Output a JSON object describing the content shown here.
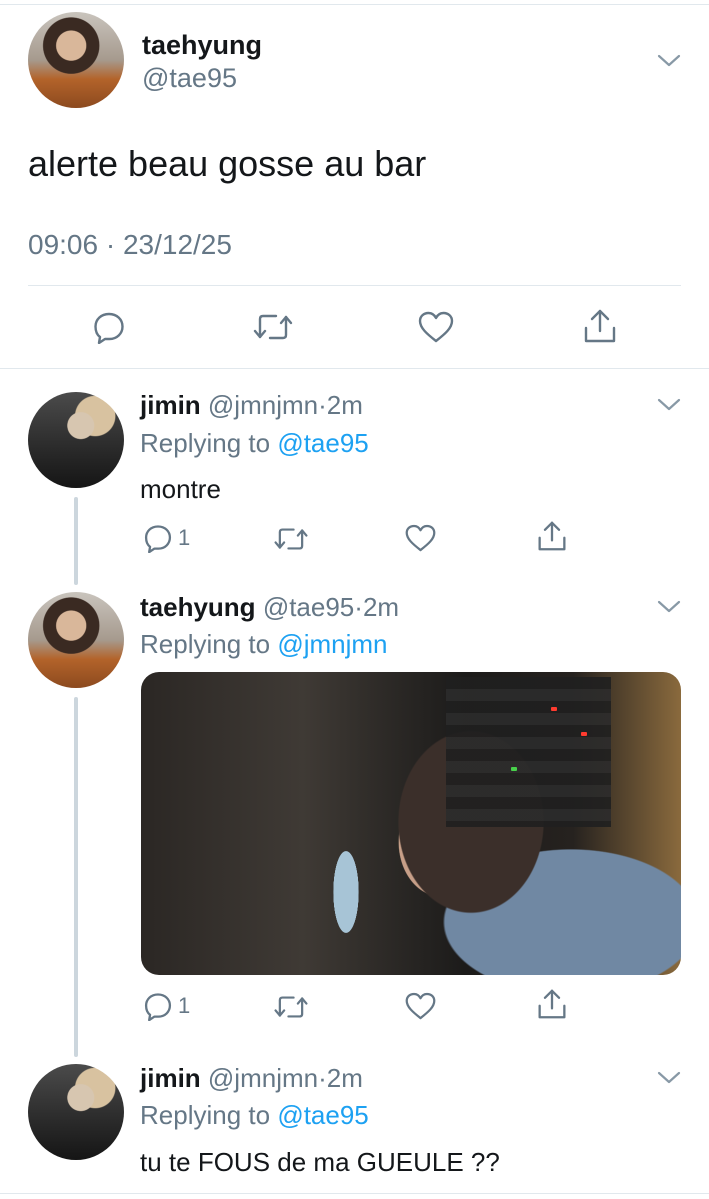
{
  "main_tweet": {
    "display_name": "taehyung",
    "handle": "@tae95",
    "text": "alerte beau gosse au bar",
    "timestamp": "09:06 · 23/12/25",
    "avatar_icon": "avatar-taehyung",
    "actions": {
      "reply_icon": "reply-icon",
      "retweet_icon": "retweet-icon",
      "like_icon": "heart-icon",
      "share_icon": "share-icon"
    }
  },
  "replies": [
    {
      "display_name": "jimin",
      "handle": "@jmnjmn",
      "separator": "·",
      "time": "2m",
      "replying_prefix": "Replying to",
      "replying_to": "@tae95",
      "text": "montre",
      "reply_count": "1"
    },
    {
      "display_name": "taehyung",
      "handle": "@tae95",
      "separator": "·",
      "time": "2m",
      "replying_prefix": "Replying to",
      "replying_to": "@jmnjmn",
      "text": "",
      "reply_count": "1",
      "has_media": true
    },
    {
      "display_name": "jimin",
      "handle": "@jmnjmn",
      "separator": "·",
      "time": "2m",
      "replying_prefix": "Replying to",
      "replying_to": "@tae95",
      "text": "tu te FOUS de ma GUEULE ??"
    }
  ],
  "colors": {
    "link": "#1da1f2",
    "muted": "#657786",
    "divider": "#e1e8ed",
    "thread_line": "#ccd6dd"
  }
}
